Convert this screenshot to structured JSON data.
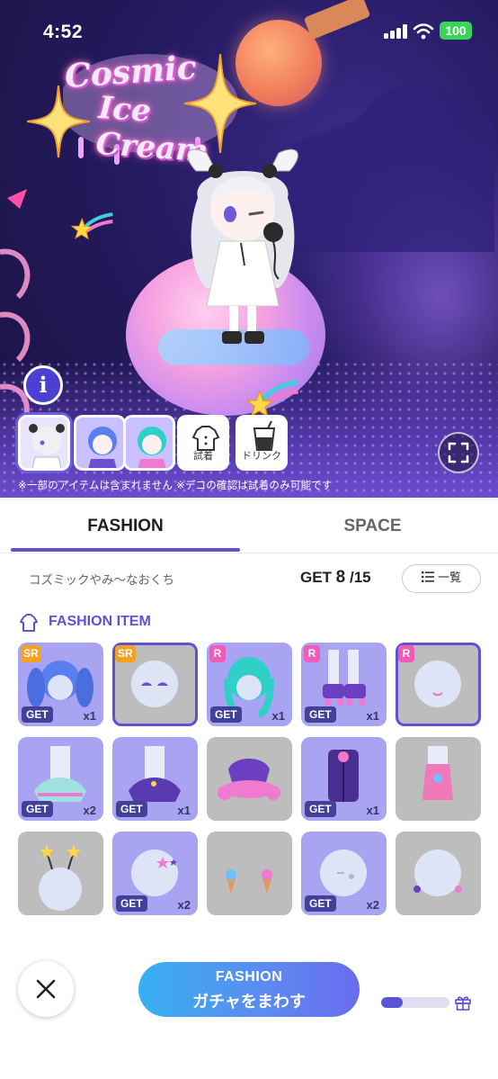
{
  "status_bar": {
    "time": "4:52",
    "battery": "100"
  },
  "hero": {
    "logo_line1": "Cosmic",
    "logo_line2": "Ice Cream",
    "info_label": "i",
    "thumbnails": [
      {
        "type": "avatar",
        "selected": true
      },
      {
        "type": "avatar",
        "selected": false
      },
      {
        "type": "avatar",
        "selected": false
      },
      {
        "type": "button",
        "label": "試着",
        "icon": "shirt-icon"
      },
      {
        "type": "button",
        "label": "ドリンク",
        "icon": "drink-icon"
      }
    ],
    "notice": "※一部のアイテムは含まれません ※デコの確認は試着のみ可能です"
  },
  "tabs": [
    {
      "label": "FASHION",
      "active": true
    },
    {
      "label": "SPACE",
      "active": false
    }
  ],
  "gacha": {
    "name": "コズミックやみ〜なおくち",
    "progress_prefix": "GET ",
    "progress_owned": "8",
    "progress_total": " /15",
    "list_button": "一覧"
  },
  "section": {
    "title": "FASHION ITEM"
  },
  "items": [
    {
      "rarity": "SR",
      "owned": true,
      "count": "x1",
      "highlight": false,
      "art": "hair-blue-twintail"
    },
    {
      "rarity": "SR",
      "owned": false,
      "count": "",
      "highlight": true,
      "art": "face-eyes"
    },
    {
      "rarity": "R",
      "owned": true,
      "count": "x1",
      "highlight": false,
      "art": "hair-teal"
    },
    {
      "rarity": "R",
      "owned": true,
      "count": "x1",
      "highlight": false,
      "art": "roller-skates"
    },
    {
      "rarity": "R",
      "owned": false,
      "count": "",
      "highlight": true,
      "art": "face-blush"
    },
    {
      "rarity": "",
      "owned": true,
      "count": "x2",
      "highlight": false,
      "art": "skirt-pastel"
    },
    {
      "rarity": "",
      "owned": true,
      "count": "x1",
      "highlight": false,
      "art": "skirt-purple"
    },
    {
      "rarity": "",
      "owned": false,
      "count": "",
      "highlight": false,
      "art": "top-ruffle"
    },
    {
      "rarity": "",
      "owned": true,
      "count": "x1",
      "highlight": false,
      "art": "jacket-purple"
    },
    {
      "rarity": "",
      "owned": false,
      "count": "",
      "highlight": false,
      "art": "dress-pink"
    },
    {
      "rarity": "",
      "owned": false,
      "count": "",
      "highlight": false,
      "art": "antenna-stars"
    },
    {
      "rarity": "",
      "owned": true,
      "count": "x2",
      "highlight": false,
      "art": "hairpin-stars"
    },
    {
      "rarity": "",
      "owned": false,
      "count": "",
      "highlight": false,
      "art": "icecream-earrings"
    },
    {
      "rarity": "",
      "owned": true,
      "count": "x2",
      "highlight": false,
      "art": "face-sticker"
    },
    {
      "rarity": "",
      "owned": false,
      "count": "",
      "highlight": false,
      "art": "star-earrings"
    }
  ],
  "get_label": "GET",
  "bottom": {
    "spin_line1": "FASHION",
    "spin_line2": "ガチャをまわす",
    "gift_progress": 0.32
  },
  "colors": {
    "accent": "#5b52d8",
    "owned_tile": "#a9a4f2",
    "empty_tile": "#bdbdbd",
    "sr": "#f2a21e",
    "r": "#f25ab8"
  }
}
